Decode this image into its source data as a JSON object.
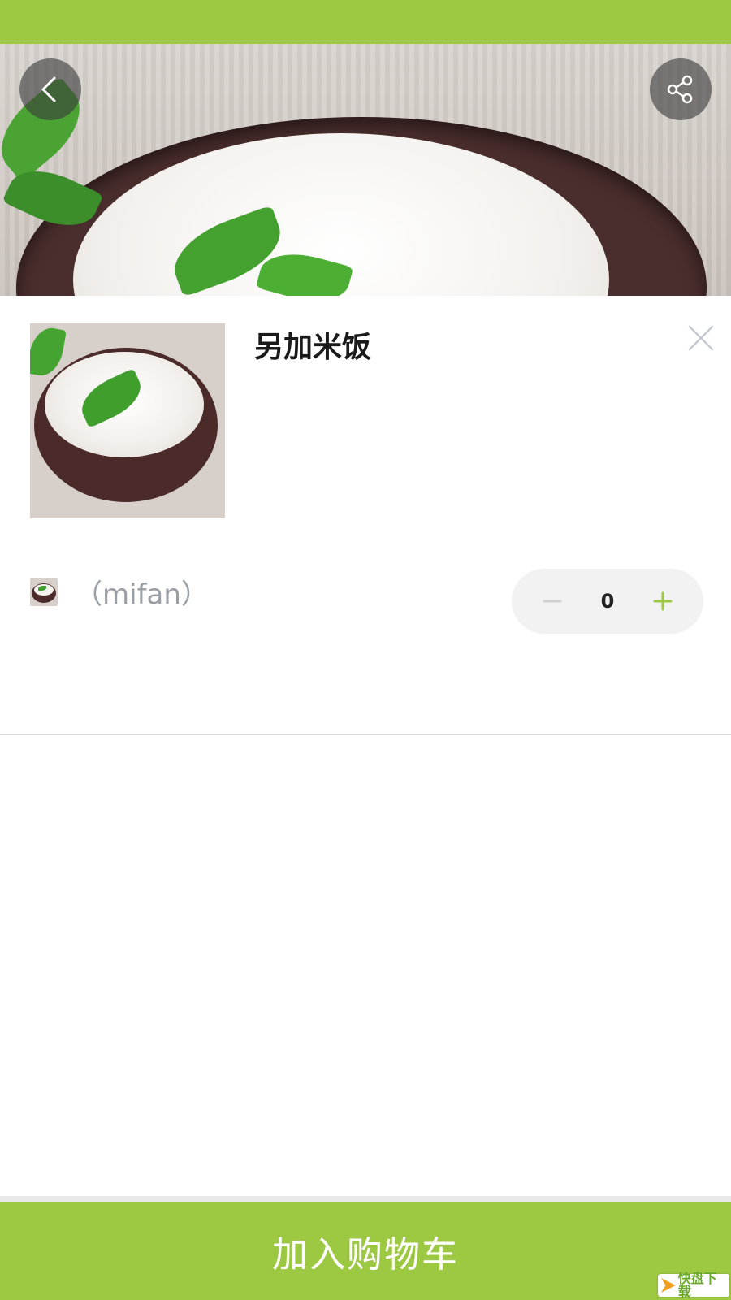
{
  "colors": {
    "accent": "#9dc841",
    "title_text": "#1a1a1a",
    "muted_text": "#9a9ea5",
    "stepper_bg": "#f2f2f2"
  },
  "product": {
    "title": "另加米饭"
  },
  "sku": {
    "label": "（mifan）"
  },
  "quantity": {
    "value": "0"
  },
  "cart_button": {
    "label": "加入购物车"
  },
  "watermark": {
    "text": "快盘下载"
  },
  "icons": {
    "back": "chevron-left-icon",
    "share": "share-icon",
    "close": "close-icon",
    "minus": "minus-icon",
    "plus": "plus-icon"
  }
}
